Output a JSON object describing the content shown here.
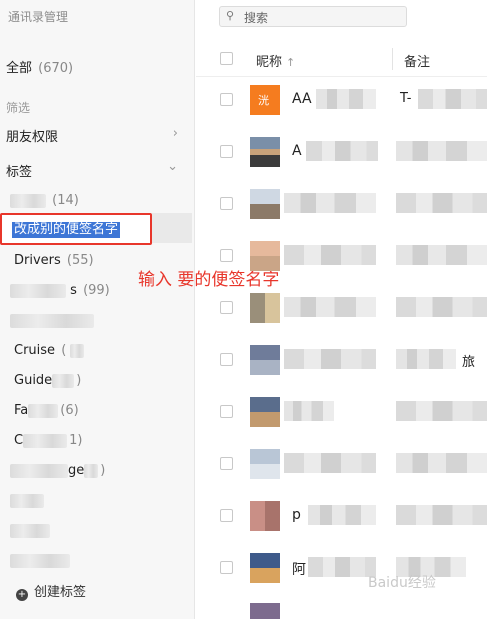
{
  "sidebar": {
    "title": "通讯录管理",
    "all_label": "全部",
    "all_count": "(670)",
    "filter_label": "筛选",
    "friend_permissions": "朋友权限",
    "tags_label": "标签",
    "tag_items": [
      {
        "label": "",
        "count": "(14)"
      },
      {
        "label": "Drivers",
        "count": "(55)"
      },
      {
        "label": "s",
        "count": "(99)"
      },
      {
        "label": "",
        "count": ""
      },
      {
        "label": "Cruise",
        "count": "("
      },
      {
        "label": "Guide",
        "count": ")"
      },
      {
        "label": "Fa",
        "count": "(6)"
      },
      {
        "label": "C",
        "count": "1)"
      },
      {
        "label": "ge",
        "count": ")"
      }
    ],
    "editing_value": "改成别的便签名字",
    "create_tag": "创建标签"
  },
  "annotation": "输入 要的便签名字",
  "search": {
    "placeholder": "搜索"
  },
  "table": {
    "col_nickname": "昵称",
    "col_remark": "备注",
    "rows": [
      {
        "nick": "AA",
        "remark": "T-"
      },
      {
        "nick": "A",
        "remark": ""
      },
      {
        "nick": "",
        "remark": ""
      },
      {
        "nick": "",
        "remark": ""
      },
      {
        "nick": "",
        "remark": ""
      },
      {
        "nick": "",
        "remark": "旅"
      },
      {
        "nick": "",
        "remark": ""
      },
      {
        "nick": "",
        "remark": ""
      },
      {
        "nick": "p",
        "remark": ""
      },
      {
        "nick": "阿",
        "remark": ""
      }
    ]
  },
  "avatar_badge": "洸",
  "watermark": "Baidu经验"
}
